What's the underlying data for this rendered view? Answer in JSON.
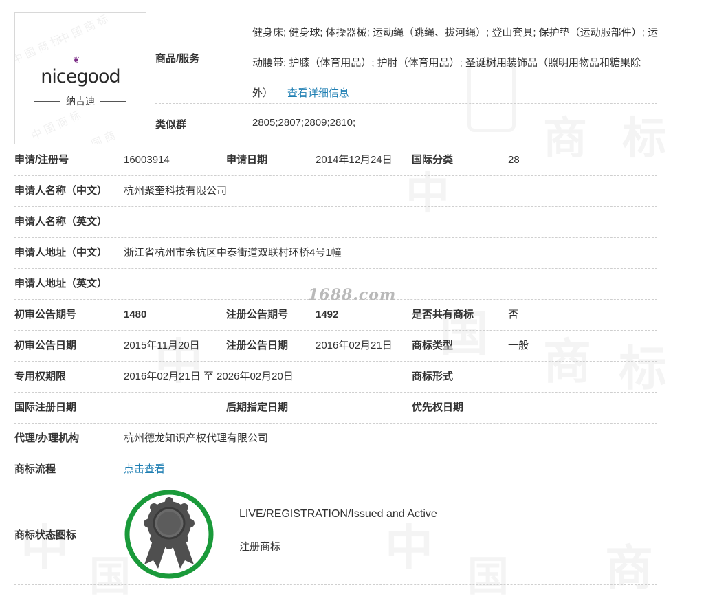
{
  "logo": {
    "brand_text": "nicegood",
    "brand_cn": "纳吉迪"
  },
  "goods": {
    "label": "商品/服务",
    "text": "健身床; 健身球; 体操器械; 运动绳（跳绳、拔河绳）; 登山套具; 保护垫（运动服部件）; 运动腰带; 护膝（体育用品）; 护肘（体育用品）; 圣诞树用装饰品（照明用物品和糖果除外）",
    "link": "查看详细信息"
  },
  "similar": {
    "label": "类似群",
    "value": "2805;2807;2809;2810;"
  },
  "rows": {
    "reg": {
      "label": "申请/注册号",
      "value": "16003914",
      "label2": "申请日期",
      "value2": "2014年12月24日",
      "label3": "国际分类",
      "value3": "28"
    },
    "name_cn": {
      "label": "申请人名称（中文）",
      "value": "杭州聚奎科技有限公司"
    },
    "name_en": {
      "label": "申请人名称（英文）",
      "value": ""
    },
    "addr_cn": {
      "label": "申请人地址（中文）",
      "value": "浙江省杭州市余杭区中泰街道双联村环桥4号1幢"
    },
    "addr_en": {
      "label": "申请人地址（英文）",
      "value": ""
    },
    "notice_no": {
      "label": "初审公告期号",
      "value": "1480",
      "label2": "注册公告期号",
      "value2": "1492",
      "label3": "是否共有商标",
      "value3": "否"
    },
    "notice_date": {
      "label": "初审公告日期",
      "value": "2015年11月20日",
      "label2": "注册公告日期",
      "value2": "2016年02月21日",
      "label3": "商标类型",
      "value3": "一般"
    },
    "term": {
      "label": "专用权期限",
      "value": "2016年02月21日 至 2026年02月20日",
      "label3": "商标形式",
      "value3": ""
    },
    "intl": {
      "label": "国际注册日期",
      "value": "",
      "label2": "后期指定日期",
      "value2": "",
      "label3": "优先权日期",
      "value3": ""
    },
    "agent": {
      "label": "代理/办理机构",
      "value": "杭州德龙知识产权代理有限公司"
    },
    "flow": {
      "label": "商标流程",
      "link": "点击查看"
    }
  },
  "status": {
    "label": "商标状态图标",
    "en": "LIVE/REGISTRATION/Issued and Active",
    "cn": "注册商标",
    "ring_color": "#1a9a3a",
    "badge_color": "#555555"
  },
  "watermark": {
    "site": "1688.com",
    "chars": [
      "中",
      "国",
      "商",
      "标"
    ]
  },
  "colors": {
    "link": "#1f7fb3",
    "label": "#333333",
    "divider": "#cfcfcf"
  }
}
